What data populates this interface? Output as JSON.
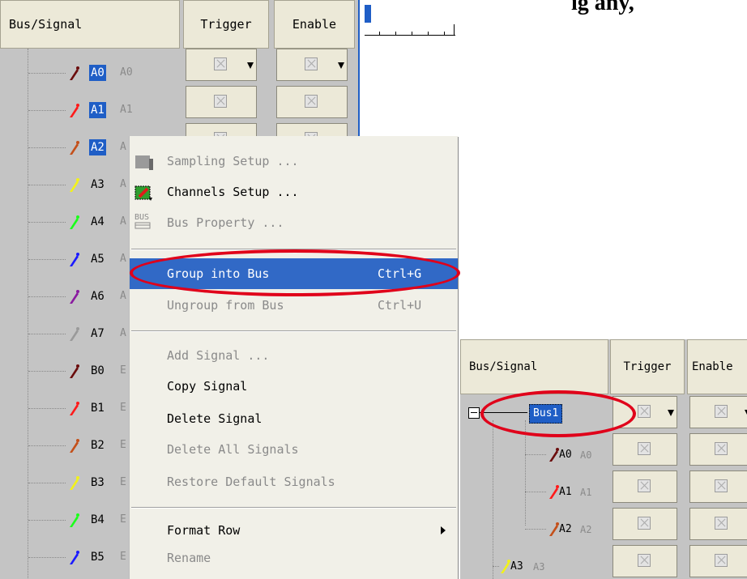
{
  "header": {
    "bus_signal": "Bus/Signal",
    "trigger": "Trigger",
    "enable": "Enable"
  },
  "caption_fragment": "ig any,",
  "signals": [
    {
      "name": "A0",
      "alias": "A0",
      "color": "#6b0d0d",
      "selected": true
    },
    {
      "name": "A1",
      "alias": "A1",
      "color": "#ff1a1a",
      "selected": true
    },
    {
      "name": "A2",
      "alias": "A",
      "color": "#c4501a",
      "selected": true
    },
    {
      "name": "A3",
      "alias": "A",
      "color": "#f2f21a",
      "selected": false
    },
    {
      "name": "A4",
      "alias": "A",
      "color": "#1aff1a",
      "selected": false
    },
    {
      "name": "A5",
      "alias": "A",
      "color": "#1a1aff",
      "selected": false
    },
    {
      "name": "A6",
      "alias": "A",
      "color": "#8a1aa0",
      "selected": false
    },
    {
      "name": "A7",
      "alias": "A",
      "color": "#9a9a9a",
      "selected": false
    },
    {
      "name": "B0",
      "alias": "E",
      "color": "#6b0d0d",
      "selected": false
    },
    {
      "name": "B1",
      "alias": "E",
      "color": "#ff1a1a",
      "selected": false
    },
    {
      "name": "B2",
      "alias": "E",
      "color": "#c4501a",
      "selected": false
    },
    {
      "name": "B3",
      "alias": "E",
      "color": "#f2f21a",
      "selected": false
    },
    {
      "name": "B4",
      "alias": "E",
      "color": "#1aff1a",
      "selected": false
    },
    {
      "name": "B5",
      "alias": "E",
      "color": "#1a1aff",
      "selected": false
    }
  ],
  "menu": {
    "sampling_setup": "Sampling Setup ...",
    "channels_setup": "Channels Setup ...",
    "bus_property": "Bus Property ...",
    "bus_icon_text": "BUS",
    "group_into_bus": "Group into Bus",
    "group_into_bus_key": "Ctrl+G",
    "ungroup_from_bus": "Ungroup from Bus",
    "ungroup_from_bus_key": "Ctrl+U",
    "add_signal": "Add Signal ...",
    "copy_signal": "Copy Signal",
    "delete_signal": "Delete Signal",
    "delete_all_signals": "Delete All Signals",
    "restore_default_signals": "Restore Default Signals",
    "format_row": "Format Row",
    "rename": "Rename"
  },
  "inset": {
    "header": {
      "bus_signal": "Bus/Signal",
      "trigger": "Trigger",
      "enable": "Enable"
    },
    "bus_name": "Bus1",
    "rows": [
      {
        "name": "A0",
        "alias": "A0",
        "color": "#6b0d0d"
      },
      {
        "name": "A1",
        "alias": "A1",
        "color": "#ff1a1a"
      },
      {
        "name": "A2",
        "alias": "A2",
        "color": "#c4501a"
      },
      {
        "name": "A3",
        "alias": "A3",
        "color": "#f2f21a"
      }
    ]
  },
  "colors": {
    "selection": "#1f5ec6",
    "menu_highlight": "#3169c6",
    "annotation": "#e0001a"
  }
}
